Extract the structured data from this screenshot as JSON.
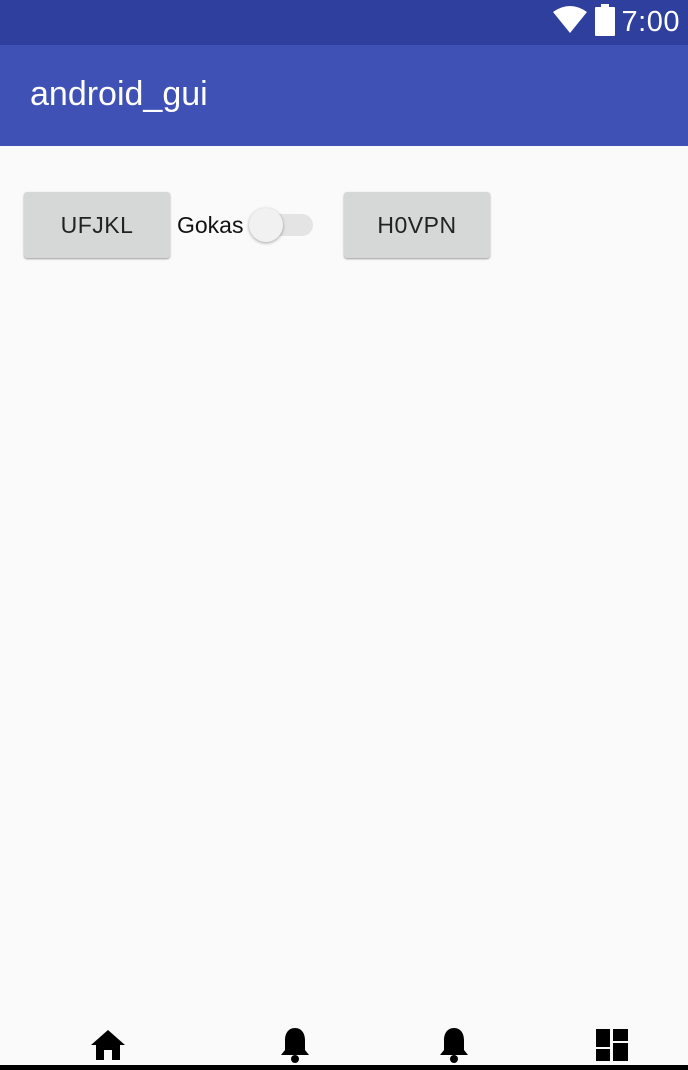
{
  "status_bar": {
    "time": "7:00",
    "icons": [
      "wifi-icon",
      "battery-icon"
    ]
  },
  "app_bar": {
    "title": "android_gui"
  },
  "main": {
    "button_left_label": "UFJKL",
    "switch_label": "Gokas",
    "switch_state": "off",
    "button_right_label": "H0VPN"
  },
  "bottom_nav": {
    "items": [
      "home-icon",
      "notifications-icon",
      "notifications-icon",
      "dashboard-icon"
    ]
  },
  "colors": {
    "status_bar": "#2f3f9e",
    "app_bar": "#3f51b5",
    "background": "#fafafa",
    "button": "#d6d7d7"
  }
}
